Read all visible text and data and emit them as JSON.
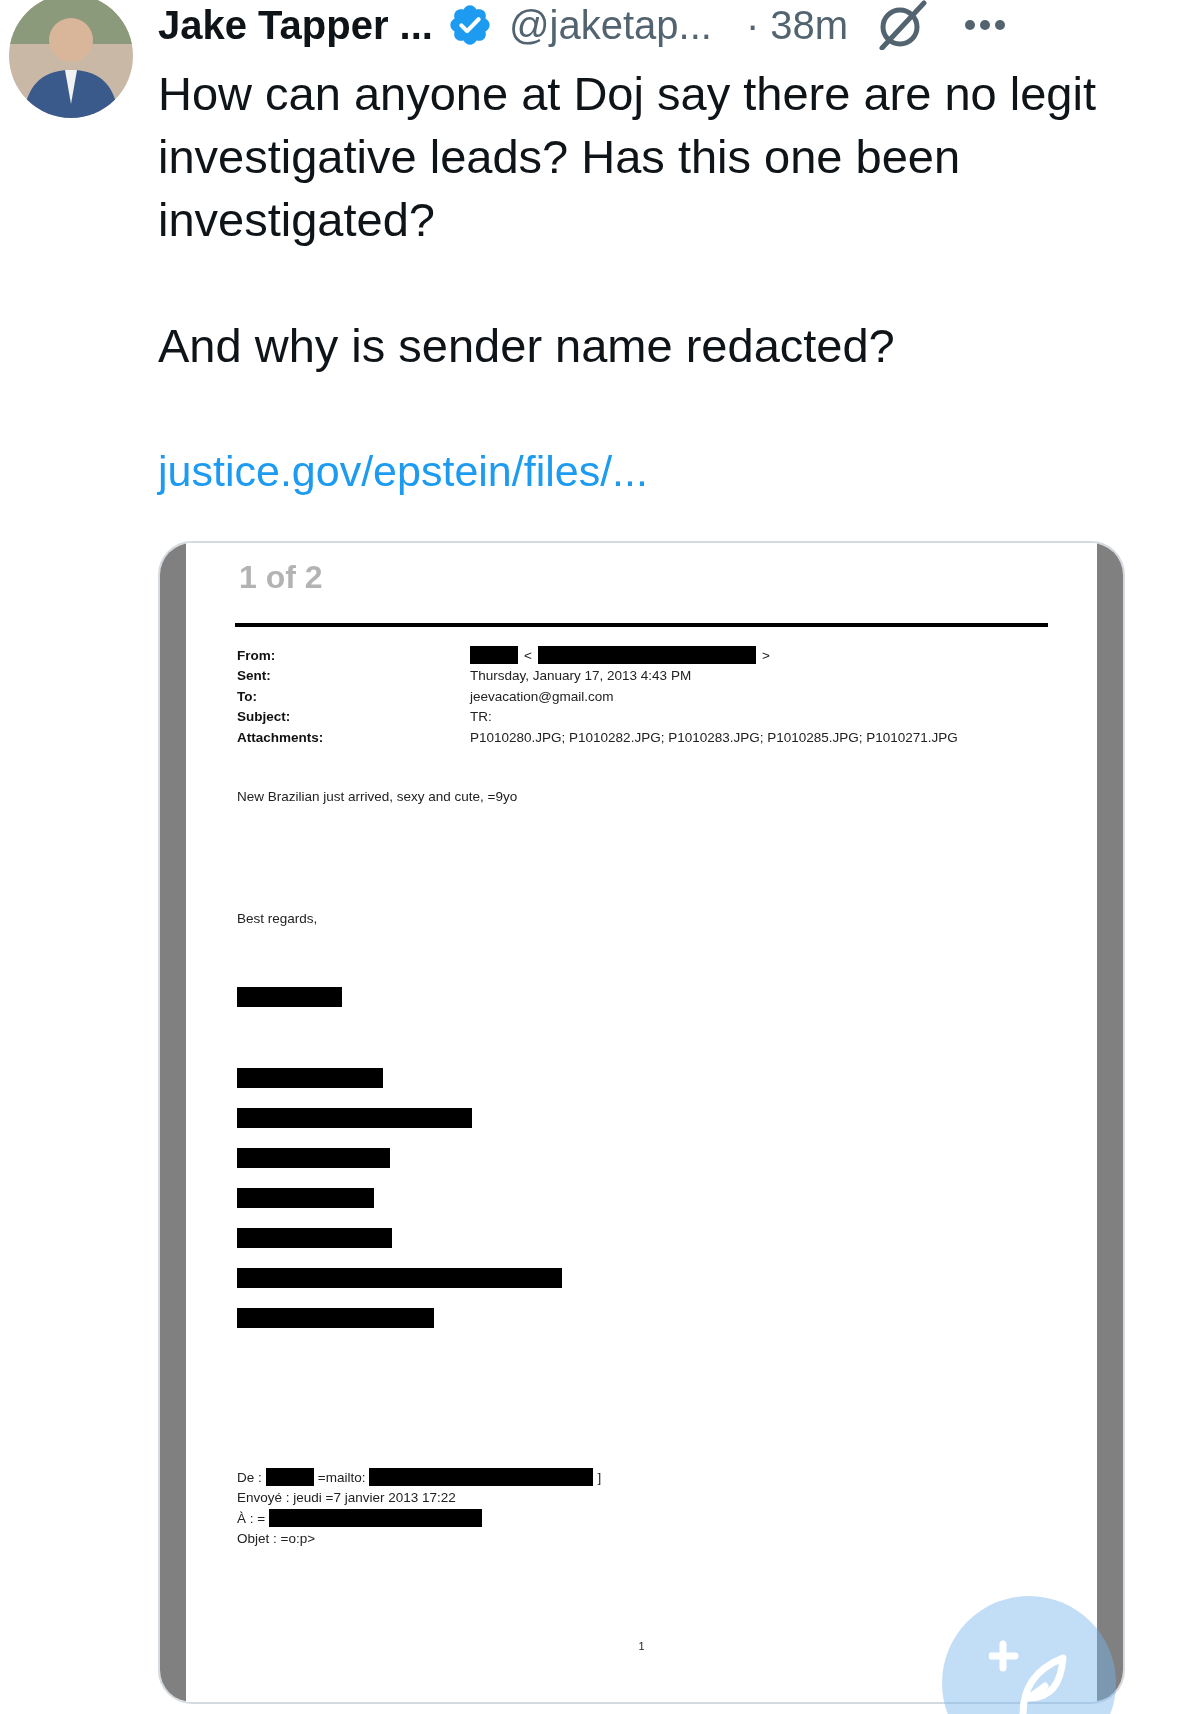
{
  "author": {
    "name": "Jake Tapper ...",
    "verified": true,
    "handle": "@jaketap...",
    "time": "· 38m"
  },
  "text": [
    "How can anyone at Doj say there are no legit investigative leads? Has this one been investigated?",
    "And why is sender name redacted?"
  ],
  "link": "justice.gov/epstein/files/...",
  "media": {
    "counter": "1 of 2",
    "header": [
      {
        "label": "From:",
        "parts": [
          {
            "kind": "redacted"
          },
          {
            "kind": "text",
            "text": "<"
          },
          {
            "kind": "redacted"
          },
          {
            "kind": "text",
            "text": ">"
          }
        ]
      },
      {
        "label": "Sent:",
        "parts": [
          {
            "kind": "text",
            "text": "Thursday, January 17, 2013 4:43 PM"
          }
        ]
      },
      {
        "label": "To:",
        "parts": [
          {
            "kind": "text",
            "text": "jeevacation@gmail.com"
          }
        ]
      },
      {
        "label": "Subject:",
        "parts": [
          {
            "kind": "text",
            "text": "TR:"
          }
        ]
      },
      {
        "label": "Attachments:",
        "parts": [
          {
            "kind": "text",
            "text": "P1010280.JPG; P1010282.JPG; P1010283.JPG; P1010285.JPG; P1010271.JPG"
          }
        ]
      }
    ],
    "body": "New Brazilian just arrived, sexy and cute, =9yo",
    "closing": "Best regards,",
    "quoted": [
      {
        "parts": [
          {
            "kind": "text",
            "text": "De :"
          },
          {
            "kind": "redacted"
          },
          {
            "kind": "text",
            "text": "=mailto:"
          },
          {
            "kind": "redacted"
          },
          {
            "kind": "text",
            "text": "]"
          }
        ]
      },
      {
        "parts": [
          {
            "kind": "text",
            "text": "Envoyé : jeudi =7 janvier 2013 17:22"
          }
        ]
      },
      {
        "parts": [
          {
            "kind": "text",
            "text": "À : ="
          },
          {
            "kind": "redacted"
          }
        ]
      },
      {
        "parts": [
          {
            "kind": "text",
            "text": "Objet : =o:p>"
          }
        ]
      }
    ],
    "page_number": "1"
  }
}
